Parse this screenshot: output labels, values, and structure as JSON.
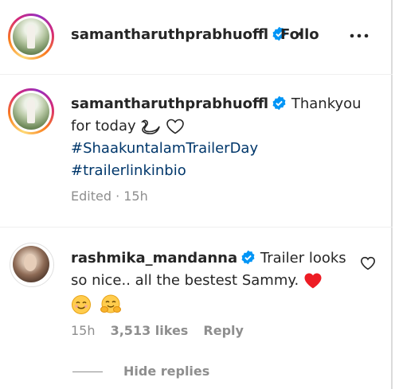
{
  "header": {
    "username": "samantharuthprabhuoffl",
    "dot": "•",
    "follow_label": "Follo",
    "more_icon": "more-horizontal-icon"
  },
  "post": {
    "username": "samantharuthprabhuoffl",
    "caption": "Thankyou",
    "caption_line2": "for today",
    "hashtag1": "#ShaakuntalamTrailerDay",
    "hashtag2": "#trailerlinkinbio",
    "meta": "Edited · 15h"
  },
  "comment": {
    "username": "rashmika_mandanna",
    "text_line1": "Trailer looks",
    "text_line2": "so nice.. all the bestest Sammy.",
    "time": "15h",
    "likes": "3,513 likes",
    "reply_label": "Reply",
    "hide_replies": "Hide replies"
  },
  "colors": {
    "text": "#262626",
    "muted": "#8e8e8e",
    "hashtag": "#00376b",
    "verified": "#0095f6",
    "heart_red": "#ed1c24"
  }
}
